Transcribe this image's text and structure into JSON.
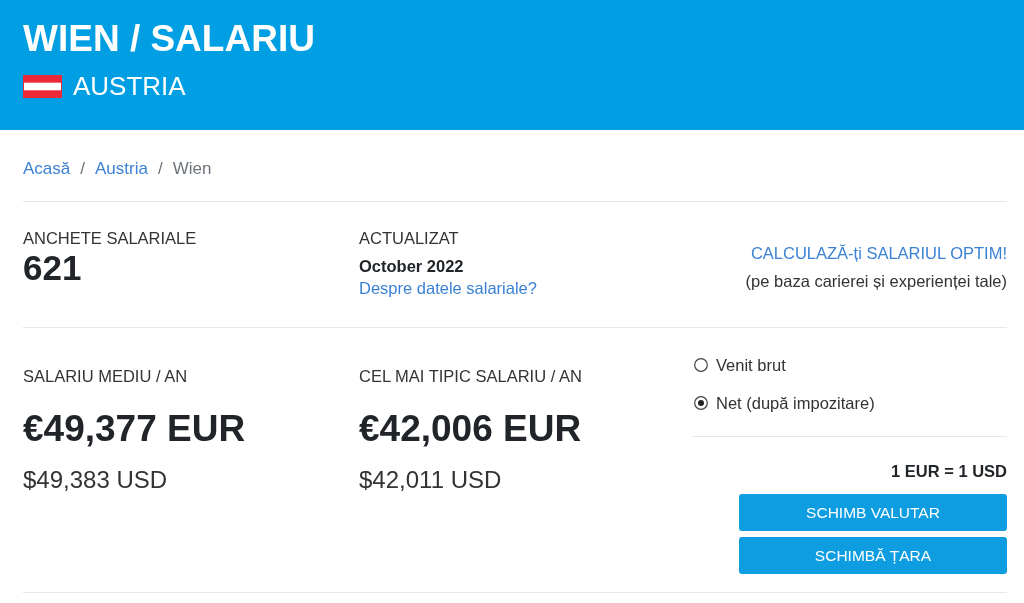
{
  "header": {
    "title": "WIEN / SALARIU",
    "country": "AUSTRIA"
  },
  "breadcrumb": {
    "separator": "/",
    "items": [
      {
        "label": "Acasă",
        "current": false
      },
      {
        "label": "Austria",
        "current": false
      },
      {
        "label": "Wien",
        "current": true
      }
    ]
  },
  "stats": [
    {
      "kind": "count",
      "label": "ANCHETE SALARIALE",
      "value": "621"
    },
    {
      "kind": "date",
      "label": "ACTUALIZAT",
      "value": "October 2022",
      "link": "Despre datele salariale?"
    }
  ],
  "calculator": {
    "link": "CALCULAZĂ-ți SALARIUL OPTIM!",
    "note": "(pe baza carierei și experienței tale)"
  },
  "salaries": [
    {
      "label": "SALARIU MEDIU / AN",
      "amount": "€49,377 EUR",
      "converted": "$49,383 USD"
    },
    {
      "label": "CEL MAI TIPIC SALARIU / AN",
      "amount": "€42,006 EUR",
      "converted": "$42,011 USD"
    }
  ],
  "income_type": [
    {
      "label": "Venit brut",
      "selected": false
    },
    {
      "label": "Net (după impozitare)",
      "selected": true
    }
  ],
  "exchange_rate": "1 EUR = 1 USD",
  "buttons": [
    "SCHIMB VALUTAR",
    "SCHIMBĂ ȚARA"
  ]
}
